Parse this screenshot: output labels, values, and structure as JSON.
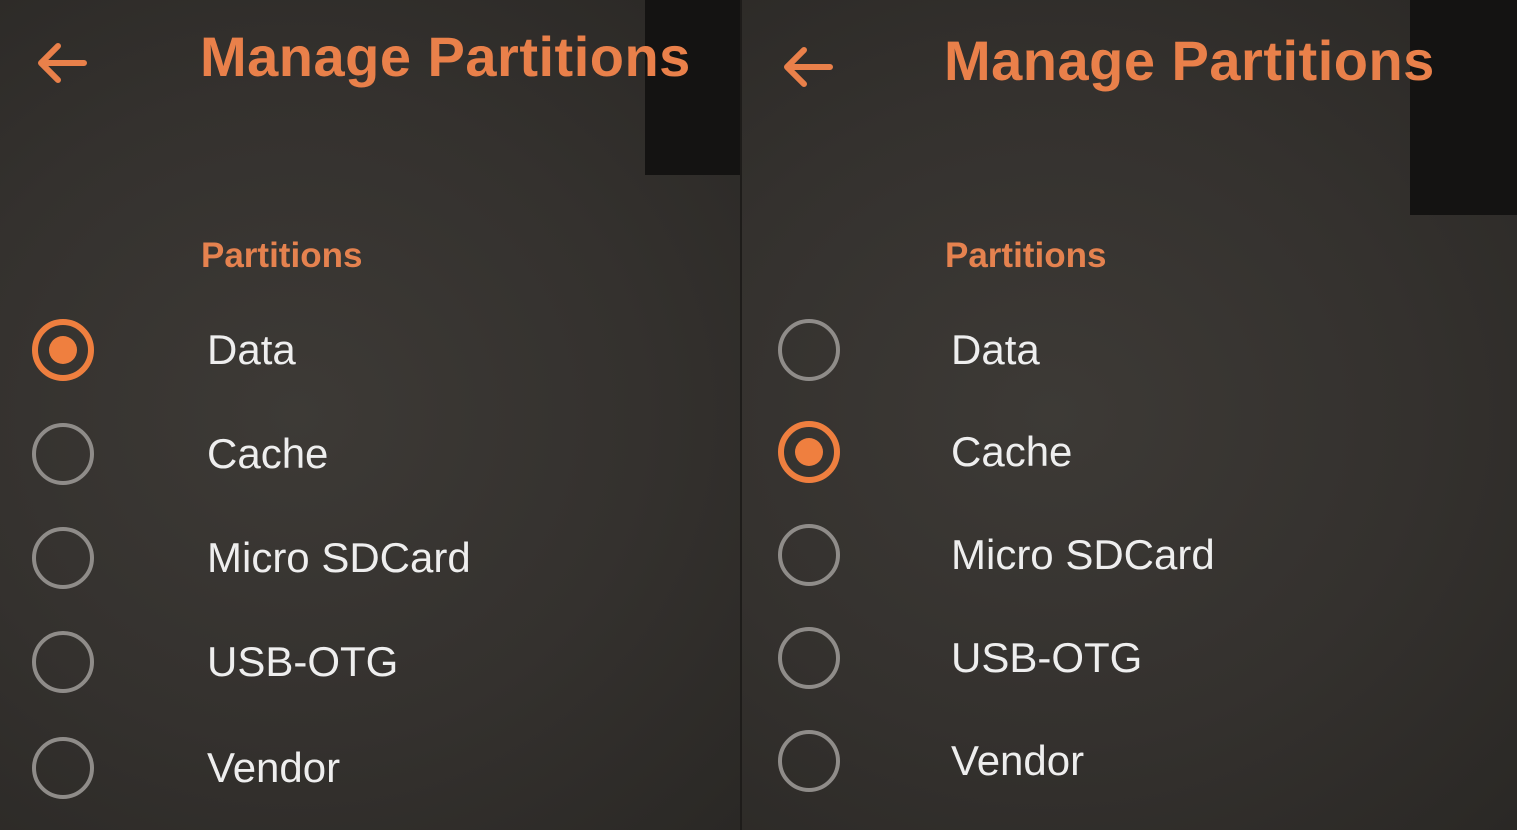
{
  "colors": {
    "accent": "#ef7f3f",
    "title": "#e9804a",
    "label": "#eeeeee",
    "radio_unselected": "#8f8c89",
    "background": "#34312e"
  },
  "panels": [
    {
      "back_icon": "arrow-back-icon",
      "title": "Manage Partitions",
      "section_header": "Partitions",
      "selected": "Data",
      "options": [
        {
          "label": "Data",
          "selected": true
        },
        {
          "label": "Cache",
          "selected": false
        },
        {
          "label": "Micro SDCard",
          "selected": false
        },
        {
          "label": "USB-OTG",
          "selected": false
        },
        {
          "label": "Vendor",
          "selected": false
        }
      ]
    },
    {
      "back_icon": "arrow-back-icon",
      "title": "Manage Partitions",
      "section_header": "Partitions",
      "selected": "Cache",
      "options": [
        {
          "label": "Data",
          "selected": false
        },
        {
          "label": "Cache",
          "selected": true
        },
        {
          "label": "Micro SDCard",
          "selected": false
        },
        {
          "label": "USB-OTG",
          "selected": false
        },
        {
          "label": "Vendor",
          "selected": false
        }
      ]
    }
  ]
}
